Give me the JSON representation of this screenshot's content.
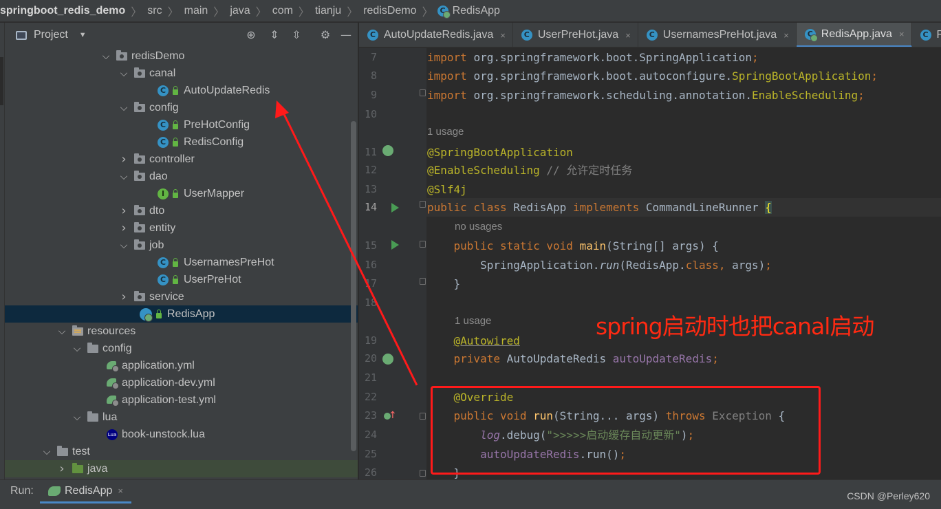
{
  "breadcrumb": {
    "items": [
      "springboot_redis_demo",
      "src",
      "main",
      "java",
      "com",
      "tianju",
      "redisDemo",
      "RedisApp"
    ]
  },
  "project_panel": {
    "title": "Project",
    "icons": [
      "project-view-icon",
      "chevron-down-icon",
      "locate-icon",
      "expand-all-icon",
      "collapse-all-icon",
      "gear-icon",
      "hide-icon"
    ],
    "tree": [
      {
        "label": "redisDemo",
        "type": "package",
        "expanded": true
      },
      {
        "label": "canal",
        "type": "package",
        "expanded": true
      },
      {
        "label": "AutoUpdateRedis",
        "type": "class"
      },
      {
        "label": "config",
        "type": "package",
        "expanded": true
      },
      {
        "label": "PreHotConfig",
        "type": "class"
      },
      {
        "label": "RedisConfig",
        "type": "class"
      },
      {
        "label": "controller",
        "type": "package",
        "expanded": false
      },
      {
        "label": "dao",
        "type": "package",
        "expanded": true
      },
      {
        "label": "UserMapper",
        "type": "interface"
      },
      {
        "label": "dto",
        "type": "package",
        "expanded": false
      },
      {
        "label": "entity",
        "type": "package",
        "expanded": false
      },
      {
        "label": "job",
        "type": "package",
        "expanded": true
      },
      {
        "label": "UsernamesPreHot",
        "type": "class"
      },
      {
        "label": "UserPreHot",
        "type": "class"
      },
      {
        "label": "service",
        "type": "package",
        "expanded": false
      },
      {
        "label": "RedisApp",
        "type": "spring-app",
        "selected": true
      },
      {
        "label": "resources",
        "type": "resources",
        "expanded": true
      },
      {
        "label": "config",
        "type": "folder",
        "expanded": true
      },
      {
        "label": "application.yml",
        "type": "yml"
      },
      {
        "label": "application-dev.yml",
        "type": "yml"
      },
      {
        "label": "application-test.yml",
        "type": "yml"
      },
      {
        "label": "lua",
        "type": "folder",
        "expanded": true
      },
      {
        "label": "book-unstock.lua",
        "type": "lua",
        "icon_text": "Lua"
      },
      {
        "label": "test",
        "type": "folder",
        "expanded": true
      },
      {
        "label": "java",
        "type": "test-source",
        "expanded": false
      }
    ]
  },
  "tabs": [
    {
      "label": "AutoUpdateRedis.java",
      "active": false
    },
    {
      "label": "UserPreHot.java",
      "active": false
    },
    {
      "label": "UsernamesPreHot.java",
      "active": false
    },
    {
      "label": "RedisApp.java",
      "active": true
    },
    {
      "label": "Re",
      "active": false
    }
  ],
  "tab_close_glyph": "×",
  "editor": {
    "hints": {
      "usage_1": "1 usage",
      "no_usages": "no usages",
      "usage_2": "1 usage"
    },
    "lines": [
      {
        "num": "7",
        "tokens": [
          [
            "kw",
            "import "
          ],
          [
            "",
            "org.springframework.boot.SpringApplication"
          ],
          [
            "kw",
            ";"
          ]
        ]
      },
      {
        "num": "8",
        "tokens": [
          [
            "kw",
            "import "
          ],
          [
            "",
            "org.springframework.boot.autoconfigure."
          ],
          [
            "ann",
            "SpringBootApplication"
          ],
          [
            "kw",
            ";"
          ]
        ]
      },
      {
        "num": "9",
        "tokens": [
          [
            "kw",
            "import "
          ],
          [
            "",
            "org.springframework.scheduling.annotation."
          ],
          [
            "ann",
            "EnableScheduling"
          ],
          [
            "kw",
            ";"
          ]
        ]
      },
      {
        "num": "10",
        "tokens": []
      },
      {
        "num": "11",
        "tokens": [
          [
            "ann",
            "@SpringBootApplication"
          ]
        ]
      },
      {
        "num": "12",
        "tokens": [
          [
            "ann",
            "@EnableScheduling "
          ],
          [
            "cmt",
            "// 允许定时任务"
          ]
        ]
      },
      {
        "num": "13",
        "tokens": [
          [
            "ann",
            "@Slf4j"
          ]
        ]
      },
      {
        "num": "14",
        "tokens": [
          [
            "kw",
            "public class "
          ],
          [
            "",
            "RedisApp "
          ],
          [
            "kw",
            "implements "
          ],
          [
            "",
            "CommandLineRunner "
          ],
          [
            "brace",
            "{"
          ]
        ]
      },
      {
        "num": "15",
        "tokens": [
          [
            "",
            "    "
          ],
          [
            "kw",
            "public static void "
          ],
          [
            "fn",
            "main"
          ],
          [
            "",
            "(String[] args) {"
          ]
        ]
      },
      {
        "num": "16",
        "tokens": [
          [
            "",
            "        SpringApplication."
          ],
          [
            "it",
            "run"
          ],
          [
            "",
            "(RedisApp."
          ],
          [
            "kw",
            "class"
          ],
          [
            "kw",
            ", "
          ],
          [
            "",
            "args)"
          ],
          [
            "kw",
            ";"
          ]
        ]
      },
      {
        "num": "17",
        "tokens": [
          [
            "",
            "    }"
          ]
        ]
      },
      {
        "num": "18",
        "tokens": []
      },
      {
        "num": "19",
        "tokens": [
          [
            "",
            "    "
          ],
          [
            "annu",
            "@Autowired"
          ]
        ]
      },
      {
        "num": "20",
        "tokens": [
          [
            "",
            "    "
          ],
          [
            "kw",
            "private "
          ],
          [
            "",
            "AutoUpdateRedis "
          ],
          [
            "fld",
            "autoUpdateRedis"
          ],
          [
            "kw",
            ";"
          ]
        ]
      },
      {
        "num": "21",
        "tokens": []
      },
      {
        "num": "22",
        "tokens": [
          [
            "",
            "    "
          ],
          [
            "ann",
            "@Override"
          ]
        ]
      },
      {
        "num": "23",
        "tokens": [
          [
            "",
            "    "
          ],
          [
            "kw",
            "public void "
          ],
          [
            "fn",
            "run"
          ],
          [
            "",
            "(String... args) "
          ],
          [
            "kw",
            "throws "
          ],
          [
            "dim",
            "Exception "
          ],
          [
            "",
            "{"
          ]
        ]
      },
      {
        "num": "24",
        "tokens": [
          [
            "",
            "        "
          ],
          [
            "fldit",
            "log"
          ],
          [
            "",
            ".debug("
          ],
          [
            "str",
            "\">>>>>启动缓存自动更新\""
          ],
          [
            "",
            ")"
          ],
          [
            "kw",
            ";"
          ]
        ]
      },
      {
        "num": "25",
        "tokens": [
          [
            "",
            "        "
          ],
          [
            "fld",
            "autoUpdateRedis"
          ],
          [
            "",
            ".run()"
          ],
          [
            "kw",
            ";"
          ]
        ]
      },
      {
        "num": "26",
        "tokens": [
          [
            "",
            "    }"
          ]
        ]
      }
    ]
  },
  "annotation": {
    "text": "spring启动时也把canal启动",
    "color": "#ff2a12"
  },
  "run_bar": {
    "label": "Run:",
    "tab_label": "RedisApp",
    "close_glyph": "×"
  },
  "watermark": "CSDN @Perley620",
  "colors": {
    "keyword": "#cc7832",
    "annotation": "#bbb529",
    "string": "#6a8759",
    "field": "#9876aa",
    "method": "#ffc66d",
    "comment": "#808080",
    "accent": "#4a88c7"
  }
}
